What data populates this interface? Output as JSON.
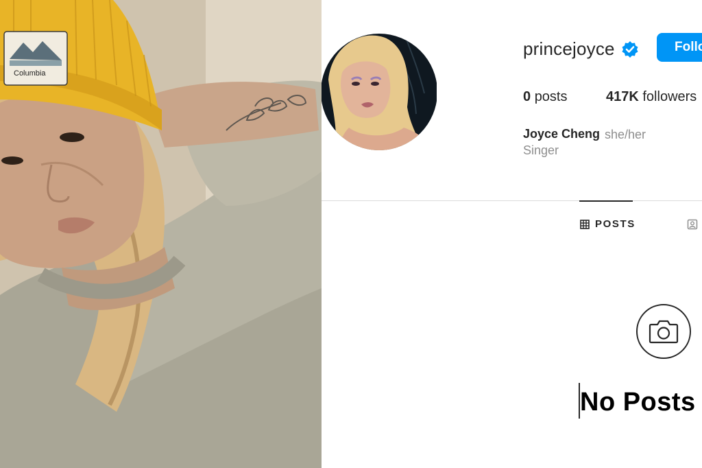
{
  "profile": {
    "username": "princejoyce",
    "follow_label": "Follow",
    "stats": {
      "posts_count": "0",
      "posts_label": "posts",
      "followers_count": "417K",
      "followers_label": "followers"
    },
    "full_name": "Joyce Cheng",
    "pronouns": "she/her",
    "bio": "Singer"
  },
  "tabs": {
    "posts_label": "POSTS"
  },
  "empty_state": {
    "title": "No Posts"
  },
  "photo": {
    "beanie_brand": "Columbia"
  },
  "colors": {
    "accent": "#0095f6",
    "text": "#262626",
    "muted": "#8e8e8e",
    "divider": "#dbdbdb",
    "beanie": "#e8b427"
  },
  "icons": {
    "verified": "verified-badge-icon",
    "grid": "grid-icon",
    "tagged": "tagged-icon",
    "camera": "camera-icon"
  }
}
